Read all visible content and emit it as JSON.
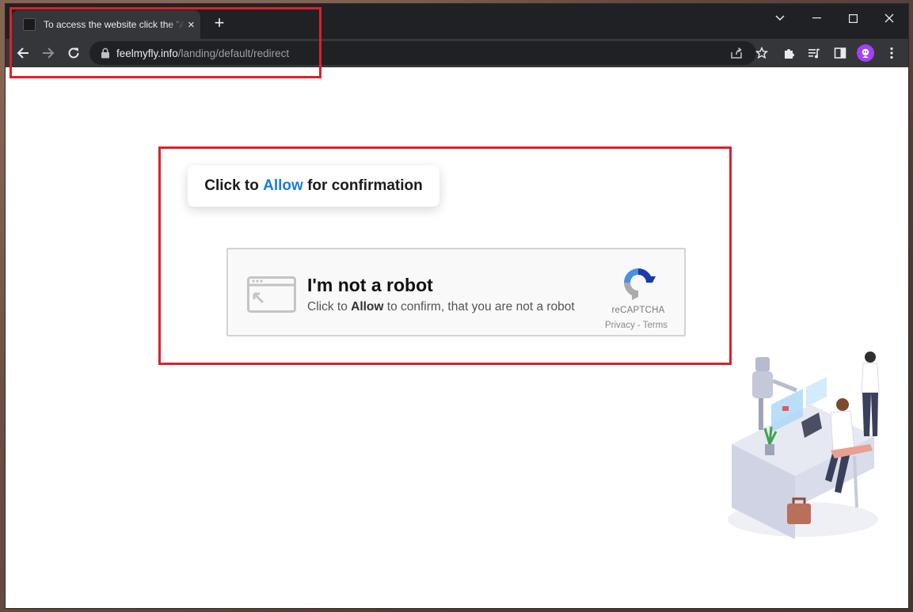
{
  "browser": {
    "tab_title": "To access the website click the \"Allow\" button",
    "new_tab_symbol": "+",
    "close_tab_symbol": "×",
    "url_host": "feelmyfly.info",
    "url_path": "/landing/default/redirect"
  },
  "page": {
    "confirm_prefix": "Click to ",
    "confirm_allow": "Allow",
    "confirm_suffix": " for confirmation",
    "captcha_title": "I'm not a robot",
    "captcha_sub_prefix": "Click to ",
    "captcha_sub_allow": "Allow",
    "captcha_sub_suffix": " to confirm, that you are not a robot",
    "recaptcha_label": "reCAPTCHA",
    "recaptcha_links": "Privacy - Terms"
  },
  "colors": {
    "highlight_border": "#d8232a",
    "allow_accent": "#1e7bd7",
    "browser_dark": "#202124"
  },
  "icons": [
    "back-arrow-icon",
    "forward-arrow-icon",
    "reload-icon",
    "lock-icon",
    "share-icon",
    "star-icon",
    "extensions-icon",
    "media-queue-icon",
    "side-panel-icon",
    "profile-avatar-icon",
    "kebab-menu-icon",
    "chevron-down-icon",
    "minimize-icon",
    "maximize-icon",
    "close-icon",
    "browser-window-icon",
    "recaptcha-logo-icon"
  ]
}
